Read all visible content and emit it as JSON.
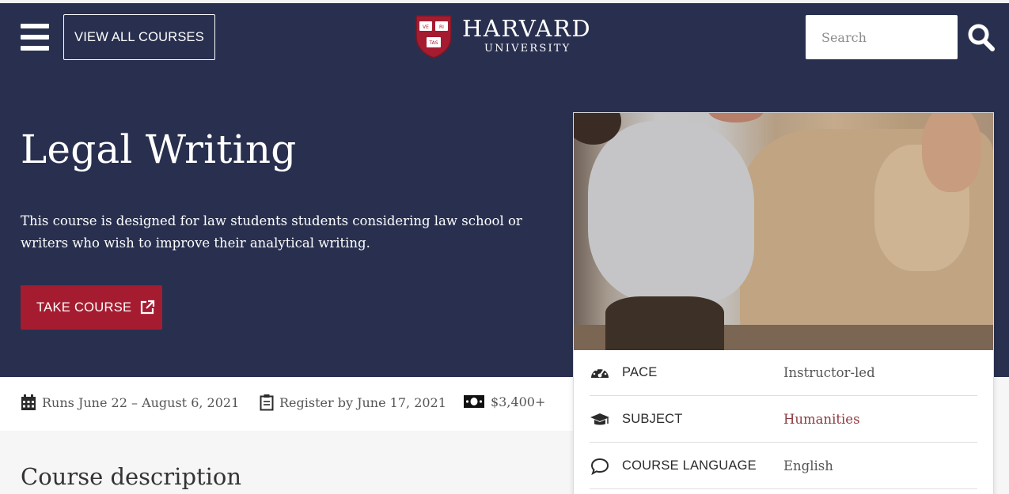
{
  "header": {
    "view_all_label": "VIEW ALL COURSES",
    "logo": {
      "name": "HARVARD",
      "subtitle": "UNIVERSITY",
      "shield_text": [
        "VE",
        "RI",
        "TAS"
      ]
    },
    "search": {
      "placeholder": "Search",
      "value": ""
    }
  },
  "course": {
    "title": "Legal Writing",
    "description": "This course is designed for law students students considering law school or writers who wish to improve their analytical writing.",
    "take_course_label": "TAKE COURSE"
  },
  "meta": {
    "runs": "Runs June 22 – August 6, 2021",
    "register": "Register by June 17, 2021",
    "price": "$3,400+"
  },
  "details": [
    {
      "icon": "gauge-icon",
      "label": "PACE",
      "value": "Instructor-led"
    },
    {
      "icon": "graduation-cap-icon",
      "label": "SUBJECT",
      "value": "Humanities"
    },
    {
      "icon": "speech-bubble-icon",
      "label": "COURSE LANGUAGE",
      "value": "English"
    }
  ],
  "section": {
    "title": "Course description"
  },
  "colors": {
    "hero": "#29304f",
    "crimson": "#a51c30",
    "link": "#8c3a3f"
  }
}
